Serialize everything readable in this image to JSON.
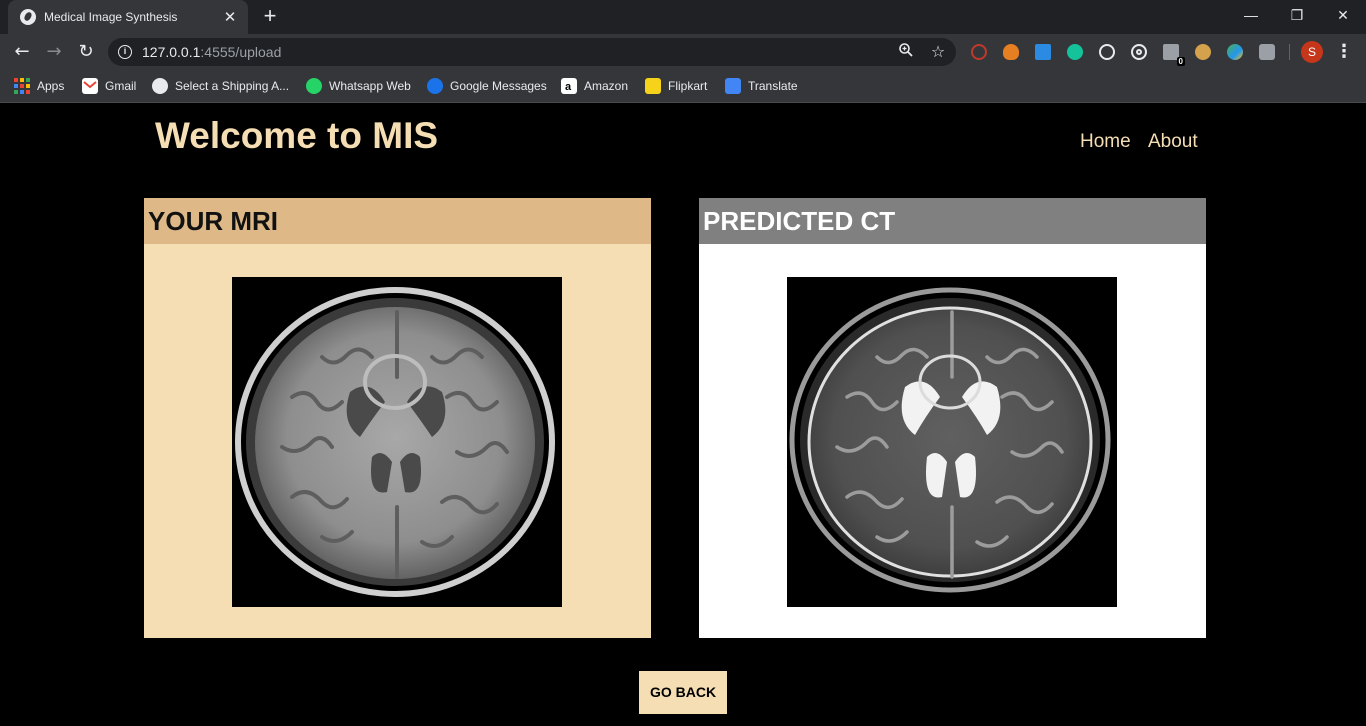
{
  "browser": {
    "tab_title": "Medical Image Synthesis",
    "tab_close": "✕",
    "new_tab": "+",
    "window_controls": {
      "minimize": "—",
      "restore": "❐",
      "close": "✕"
    },
    "nav": {
      "back": "←",
      "forward": "→",
      "reload": "↻"
    },
    "url_host": "127.0.0.1",
    "url_rest": ":4555/upload",
    "profile_initial": "S",
    "extension_badge": "0",
    "menu": "⋮",
    "bookmarks": [
      "Apps",
      "Gmail",
      "Select a Shipping A...",
      "Whatsapp Web",
      "Google Messages",
      "Amazon",
      "Flipkart",
      "Translate"
    ]
  },
  "site": {
    "title": "Welcome to MIS",
    "nav": {
      "home": "Home",
      "about": "About"
    }
  },
  "panels": {
    "mri": {
      "heading": "YOUR MRI",
      "head_color": "#deb887",
      "body_color": "#f5deb3",
      "image": "mri-brain-scan"
    },
    "ct": {
      "heading": "PREDICTED CT",
      "head_color": "#808080",
      "body_color": "#ffffff",
      "image": "predicted-ct-brain-scan"
    }
  },
  "actions": {
    "go_back": "GO BACK"
  },
  "colors": {
    "accent": "#f5deb3",
    "page_bg": "#000000"
  }
}
